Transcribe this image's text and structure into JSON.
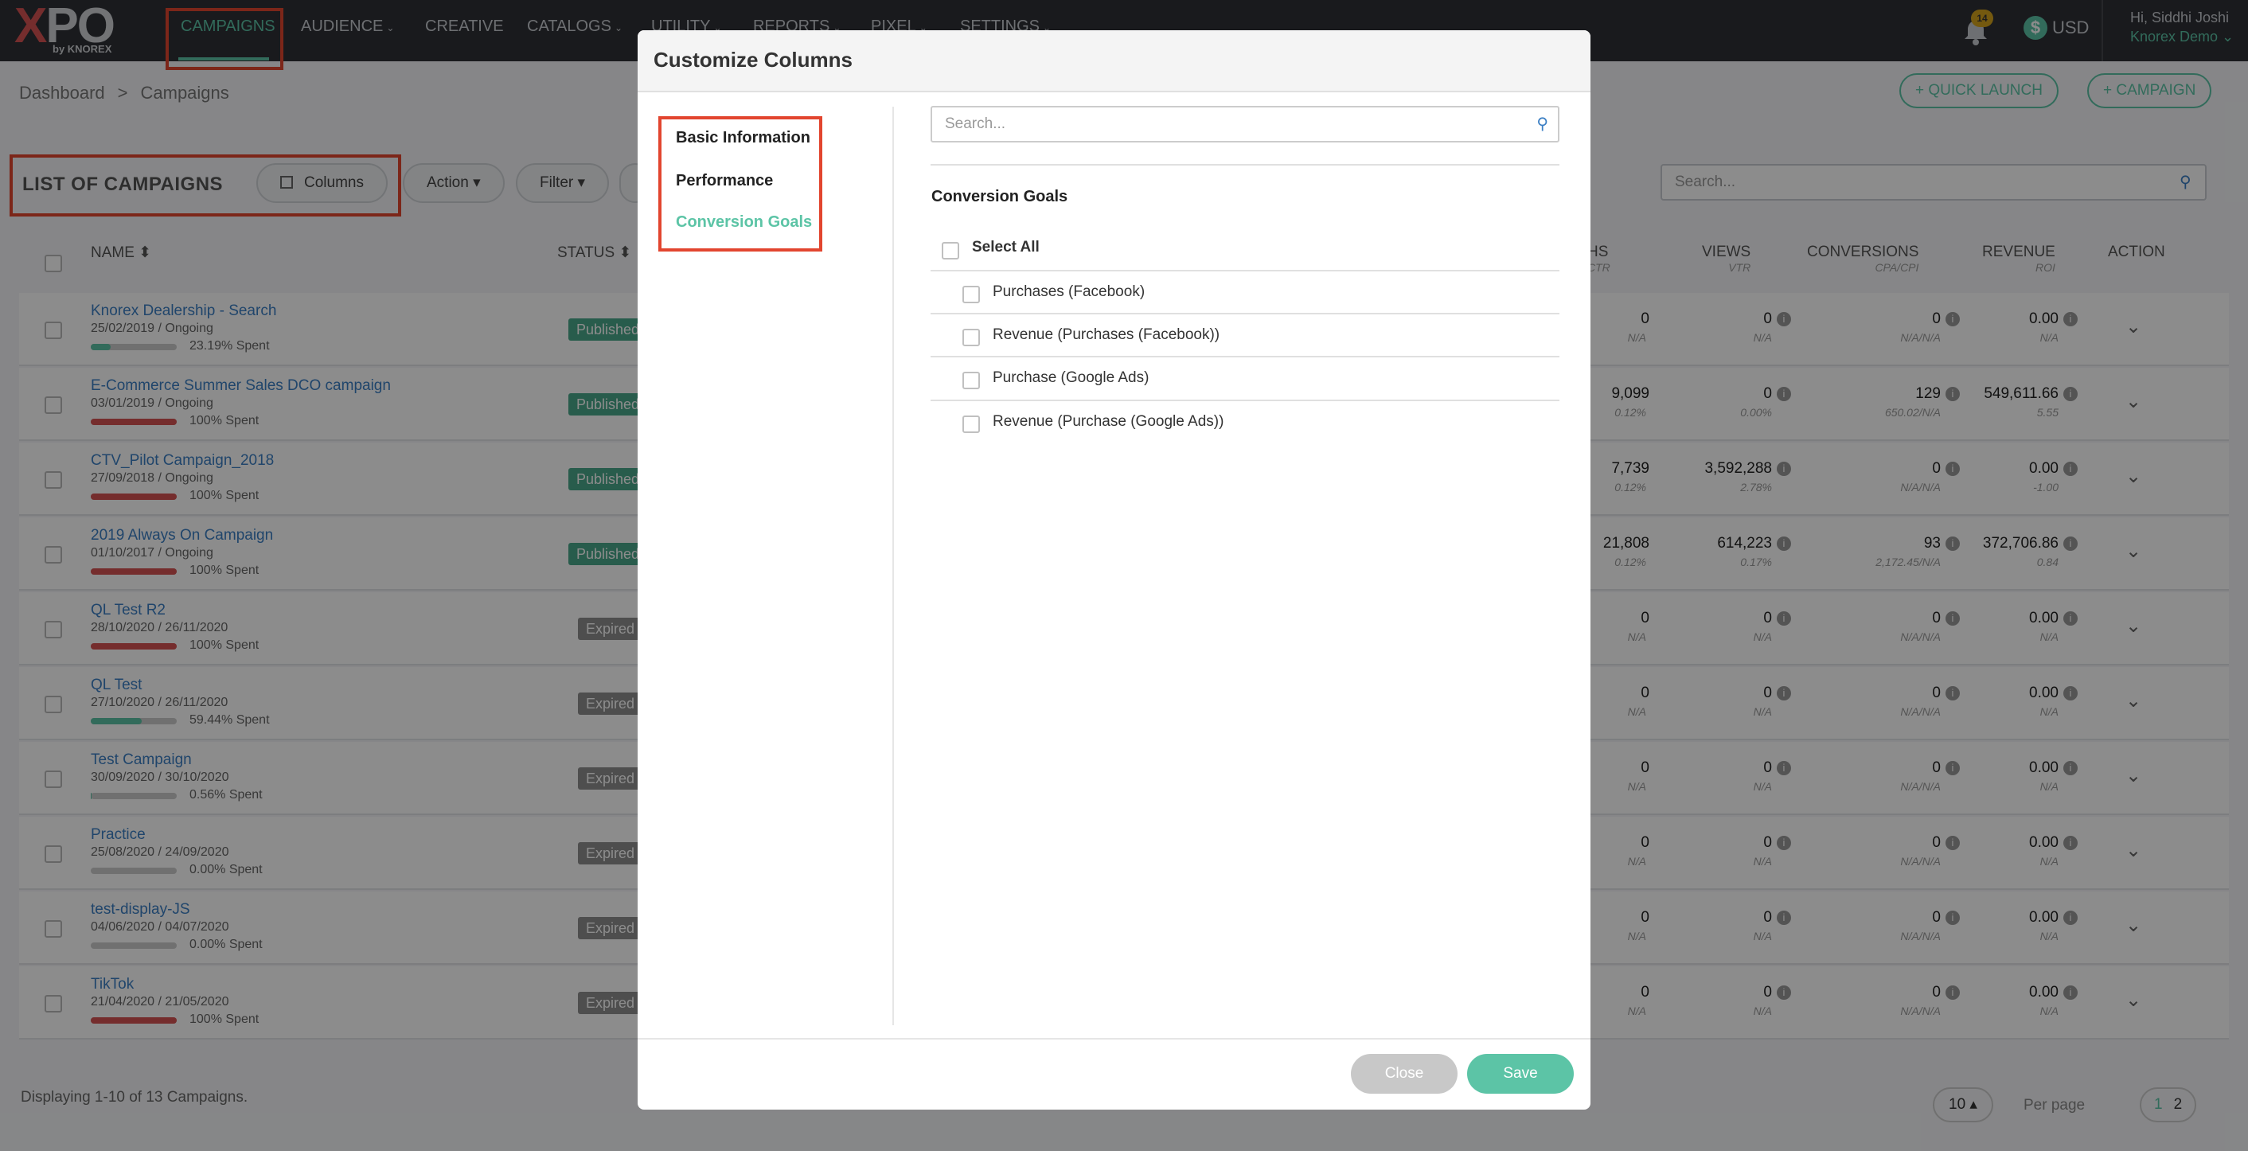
{
  "brand": {
    "logo": "XPO",
    "byline": "by KNOREX"
  },
  "nav": {
    "items": [
      {
        "label": "CAMPAIGNS",
        "caret": ""
      },
      {
        "label": "AUDIENCE",
        "caret": "⌄"
      },
      {
        "label": "CREATIVE",
        "caret": ""
      },
      {
        "label": "CATALOGS",
        "caret": "⌄"
      },
      {
        "label": "UTILITY",
        "caret": "⌄"
      },
      {
        "label": "REPORTS",
        "caret": "⌄"
      },
      {
        "label": "PIXEL",
        "caret": "⌄"
      },
      {
        "label": "SETTINGS",
        "caret": "⌄"
      }
    ]
  },
  "notifications": {
    "count": "14"
  },
  "currency": {
    "symbol": "$",
    "label": "USD"
  },
  "user": {
    "greeting": "Hi, Siddhi Joshi",
    "org": "Knorex Demo ⌄"
  },
  "breadcrumb": {
    "root": "Dashboard",
    "sep": ">",
    "current": "Campaigns"
  },
  "actions": {
    "quick_launch": "+ QUICK LAUNCH",
    "campaign": "+ CAMPAIGN"
  },
  "list": {
    "title": "LIST OF CAMPAIGNS",
    "columns_btn": "Columns",
    "action_btn": "Action ▾",
    "filter_btn": "Filter ▾",
    "search_placeholder": "Search..."
  },
  "table": {
    "headers": {
      "name": "NAME",
      "status": "STATUS",
      "hs": "HS",
      "hs_sub": "CTR",
      "views": "VIEWS",
      "views_sub": "VTR",
      "conversions": "CONVERSIONS",
      "conversions_sub": "CPA/CPI",
      "revenue": "REVENUE",
      "revenue_sub": "ROI",
      "action": "ACTION"
    },
    "rows": [
      {
        "name": "Knorex Dealership - Search",
        "dates": "25/02/2019  /  Ongoing",
        "spent": "23.19% Spent",
        "spent_pct": 23.19,
        "bar_color": "#5cc4a6",
        "status": "Published",
        "hs": "0",
        "hs_sub": "N/A",
        "views": "0",
        "views_sub": "N/A",
        "conv": "0",
        "conv_sub": "N/A/N/A",
        "rev": "0.00",
        "rev_sub": "N/A"
      },
      {
        "name": "E-Commerce Summer Sales DCO campaign",
        "dates": "03/01/2019  /  Ongoing",
        "spent": "100% Spent",
        "spent_pct": 100,
        "bar_color": "#d65353",
        "status": "Published",
        "hs": "9,099",
        "hs_sub": "0.12%",
        "views": "0",
        "views_sub": "0.00%",
        "conv": "129",
        "conv_sub": "650.02/N/A",
        "rev": "549,611.66",
        "rev_sub": "5.55"
      },
      {
        "name": "CTV_Pilot Campaign_2018",
        "dates": "27/09/2018  /  Ongoing",
        "spent": "100% Spent",
        "spent_pct": 100,
        "bar_color": "#d65353",
        "status": "Published",
        "hs": "7,739",
        "hs_sub": "0.12%",
        "views": "3,592,288",
        "views_sub": "2.78%",
        "conv": "0",
        "conv_sub": "N/A/N/A",
        "rev": "0.00",
        "rev_sub": "-1.00"
      },
      {
        "name": "2019 Always On Campaign",
        "dates": "01/10/2017  /  Ongoing",
        "spent": "100% Spent",
        "spent_pct": 100,
        "bar_color": "#d65353",
        "status": "Published",
        "hs": "21,808",
        "hs_sub": "0.12%",
        "views": "614,223",
        "views_sub": "0.17%",
        "conv": "93",
        "conv_sub": "2,172.45/N/A",
        "rev": "372,706.86",
        "rev_sub": "0.84"
      },
      {
        "name": "QL Test R2",
        "dates": "28/10/2020  /  26/11/2020",
        "spent": "100% Spent",
        "spent_pct": 100,
        "bar_color": "#d65353",
        "status": "Expired",
        "hs": "0",
        "hs_sub": "N/A",
        "views": "0",
        "views_sub": "N/A",
        "conv": "0",
        "conv_sub": "N/A/N/A",
        "rev": "0.00",
        "rev_sub": "N/A"
      },
      {
        "name": "QL Test",
        "dates": "27/10/2020  /  26/11/2020",
        "spent": "59.44% Spent",
        "spent_pct": 59.44,
        "bar_color": "#5cc4a6",
        "status": "Expired",
        "hs": "0",
        "hs_sub": "N/A",
        "views": "0",
        "views_sub": "N/A",
        "conv": "0",
        "conv_sub": "N/A/N/A",
        "rev": "0.00",
        "rev_sub": "N/A"
      },
      {
        "name": "Test Campaign",
        "dates": "30/09/2020  /  30/10/2020",
        "spent": "0.56% Spent",
        "spent_pct": 0.56,
        "bar_color": "#5cc4a6",
        "status": "Expired",
        "hs": "0",
        "hs_sub": "N/A",
        "views": "0",
        "views_sub": "N/A",
        "conv": "0",
        "conv_sub": "N/A/N/A",
        "rev": "0.00",
        "rev_sub": "N/A"
      },
      {
        "name": "Practice",
        "dates": "25/08/2020  /  24/09/2020",
        "spent": "0.00% Spent",
        "spent_pct": 0,
        "bar_color": "#5cc4a6",
        "status": "Expired",
        "hs": "0",
        "hs_sub": "N/A",
        "views": "0",
        "views_sub": "N/A",
        "conv": "0",
        "conv_sub": "N/A/N/A",
        "rev": "0.00",
        "rev_sub": "N/A"
      },
      {
        "name": "test-display-JS",
        "dates": "04/06/2020  /  04/07/2020",
        "spent": "0.00% Spent",
        "spent_pct": 0,
        "bar_color": "#5cc4a6",
        "status": "Expired",
        "hs": "0",
        "hs_sub": "N/A",
        "views": "0",
        "views_sub": "N/A",
        "conv": "0",
        "conv_sub": "N/A/N/A",
        "rev": "0.00",
        "rev_sub": "N/A"
      },
      {
        "name": "TikTok",
        "dates": "21/04/2020  /  21/05/2020",
        "spent": "100% Spent",
        "spent_pct": 100,
        "bar_color": "#d65353",
        "status": "Expired",
        "hs": "0",
        "hs_sub": "N/A",
        "views": "0",
        "views_sub": "N/A",
        "conv": "0",
        "conv_sub": "N/A/N/A",
        "rev": "0.00",
        "rev_sub": "N/A"
      }
    ]
  },
  "footer": {
    "displaying": "Displaying 1-10 of 13 Campaigns.",
    "per_page_value": "10 ▴",
    "per_page_label": "Per page",
    "pages": [
      "1",
      "2"
    ]
  },
  "modal": {
    "title": "Customize Columns",
    "nav": [
      {
        "label": "Basic Information"
      },
      {
        "label": "Performance"
      },
      {
        "label": "Conversion Goals"
      }
    ],
    "search_placeholder": "Search...",
    "section_title": "Conversion Goals",
    "select_all": "Select All",
    "options": [
      {
        "label": "Purchases (Facebook)"
      },
      {
        "label": "Revenue (Purchases (Facebook))"
      },
      {
        "label": "Purchase (Google Ads)"
      },
      {
        "label": "Revenue (Purchase (Google Ads))"
      }
    ],
    "close_label": "Close",
    "save_label": "Save"
  },
  "colors": {
    "accent": "#5cc4a6",
    "highlight": "#e2452f",
    "published": "#4aa88a",
    "expired": "#8e8e8e",
    "link": "#3b7fc4"
  }
}
